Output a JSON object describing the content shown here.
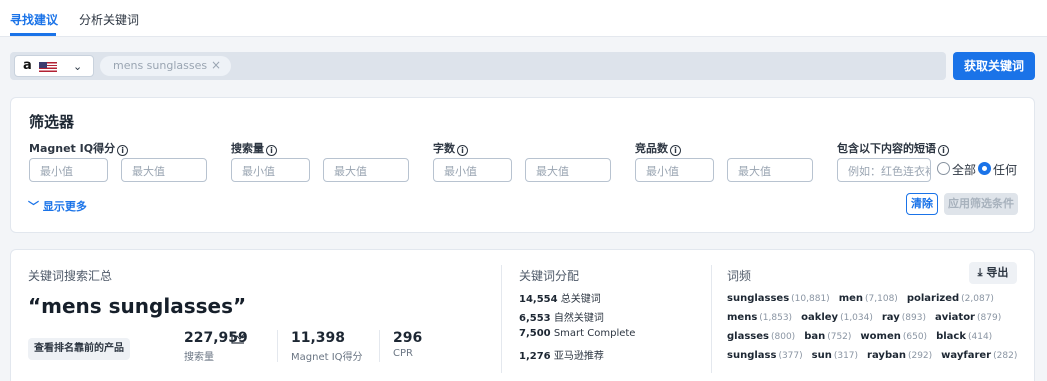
{
  "tabs": [
    {
      "label": "寻找建议",
      "active": true
    },
    {
      "label": "分析关键词",
      "active": false
    }
  ],
  "search": {
    "marketplace_logo": "a",
    "marketplace_flag": "US",
    "chip_text": "mens sunglasses",
    "chip_close": "×",
    "button": "获取关键词"
  },
  "filters": {
    "title": "筛选器",
    "groups": [
      {
        "label": "Magnet IQ得分",
        "min_placeholder": "最小值",
        "max_placeholder": "最大值"
      },
      {
        "label": "搜索量",
        "min_placeholder": "最小值",
        "max_placeholder": "最大值"
      },
      {
        "label": "字数",
        "min_placeholder": "最小值",
        "max_placeholder": "最大值"
      },
      {
        "label": "竞品数",
        "min_placeholder": "最小值",
        "max_placeholder": "最大值"
      }
    ],
    "phrase_label": "包含以下内容的短语",
    "phrase_placeholder": "例如：红色连衣裙",
    "radio_all": "全部",
    "radio_any": "任何",
    "show_more": "显示更多",
    "clear": "清除",
    "apply": "应用筛选条件"
  },
  "summary": {
    "title": "关键词搜索汇总",
    "keyword": "“mens sunglasses”",
    "top_products_button": "查看排名靠前的产品",
    "metrics": [
      {
        "value": "227,959",
        "label": "搜索量"
      },
      {
        "value": "11,398",
        "label": "Magnet IQ得分"
      },
      {
        "value": "296",
        "label": "CPR"
      }
    ]
  },
  "distribution": {
    "title": "关键词分配",
    "rows": [
      {
        "value": "14,554",
        "label": "总关键词"
      },
      {
        "value": "6,553",
        "label": "自然关键词"
      },
      {
        "value": "7,500",
        "label": "Smart Complete"
      },
      {
        "value": "1,276",
        "label": "亚马逊推荐"
      }
    ]
  },
  "frequency": {
    "title": "词频",
    "export": "导出",
    "rows": [
      [
        {
          "word": "sunglasses",
          "count": "(10,881)"
        },
        {
          "word": "men",
          "count": "(7,108)"
        },
        {
          "word": "polarized",
          "count": "(2,087)"
        }
      ],
      [
        {
          "word": "mens",
          "count": "(1,853)"
        },
        {
          "word": "oakley",
          "count": "(1,034)"
        },
        {
          "word": "ray",
          "count": "(893)"
        },
        {
          "word": "aviator",
          "count": "(879)"
        }
      ],
      [
        {
          "word": "glasses",
          "count": "(800)"
        },
        {
          "word": "ban",
          "count": "(752)"
        },
        {
          "word": "women",
          "count": "(650)"
        },
        {
          "word": "black",
          "count": "(414)"
        }
      ],
      [
        {
          "word": "sunglass",
          "count": "(377)"
        },
        {
          "word": "sun",
          "count": "(317)"
        },
        {
          "word": "rayban",
          "count": "(292)"
        },
        {
          "word": "wayfarer",
          "count": "(282)"
        }
      ]
    ]
  },
  "colors": {
    "accent": "#1a73e8"
  }
}
